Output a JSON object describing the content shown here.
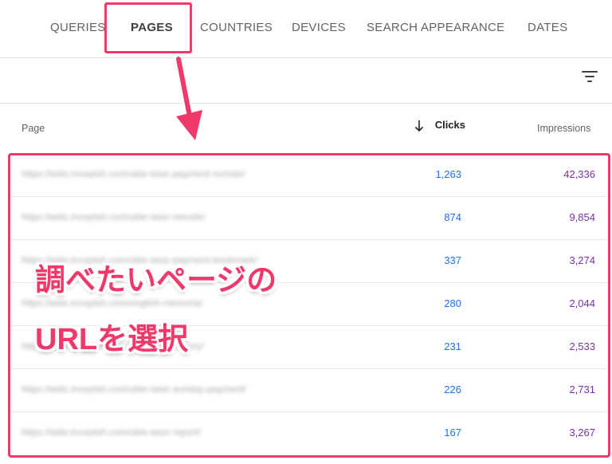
{
  "tabs": [
    {
      "label": "QUERIES"
    },
    {
      "label": "PAGES"
    },
    {
      "label": "COUNTRIES"
    },
    {
      "label": "DEVICES"
    },
    {
      "label": "SEARCH APPEARANCE"
    },
    {
      "label": "DATES"
    }
  ],
  "active_tab": "PAGES",
  "toolbar": {
    "filter_icon": "filter-icon"
  },
  "table": {
    "columns": {
      "page": "Page",
      "clicks": "Clicks",
      "impressions": "Impressions"
    },
    "sort": {
      "column": "Clicks",
      "direction": "descending"
    },
    "rows": [
      {
        "url": "https://wiiis.inceplsh.com/ubie-lasic-payment-remote/",
        "clicks": "1,263",
        "impressions": "42,336"
      },
      {
        "url": "https://wiiis.inceplsh.com/ubie-lasic-remote/",
        "clicks": "874",
        "impressions": "9,854"
      },
      {
        "url": "https://wiiis.inceplsh.com/ubie-lasic-payment-bookmark/",
        "clicks": "337",
        "impressions": "3,274"
      },
      {
        "url": "https://wiiis.inceplsh.com/english-memoria/",
        "clicks": "280",
        "impressions": "2,044"
      },
      {
        "url": "https://wiiis.inceplsh.com/ubie-lasic-history/",
        "clicks": "231",
        "impressions": "2,533"
      },
      {
        "url": "https://wiiis.inceplsh.com/ubie-lasic-sunday-payment/",
        "clicks": "226",
        "impressions": "2,731"
      },
      {
        "url": "https://wiiis.inceplsh.com/ubie-lasic-report/",
        "clicks": "167",
        "impressions": "3,267"
      }
    ]
  },
  "annotation": {
    "line1": "調べたいページの",
    "line2": "URLを選択",
    "color": "#f0386b"
  },
  "colors": {
    "clicks": "#1a73e8",
    "impressions": "#7b2ea8",
    "highlight": "#f0386b"
  }
}
